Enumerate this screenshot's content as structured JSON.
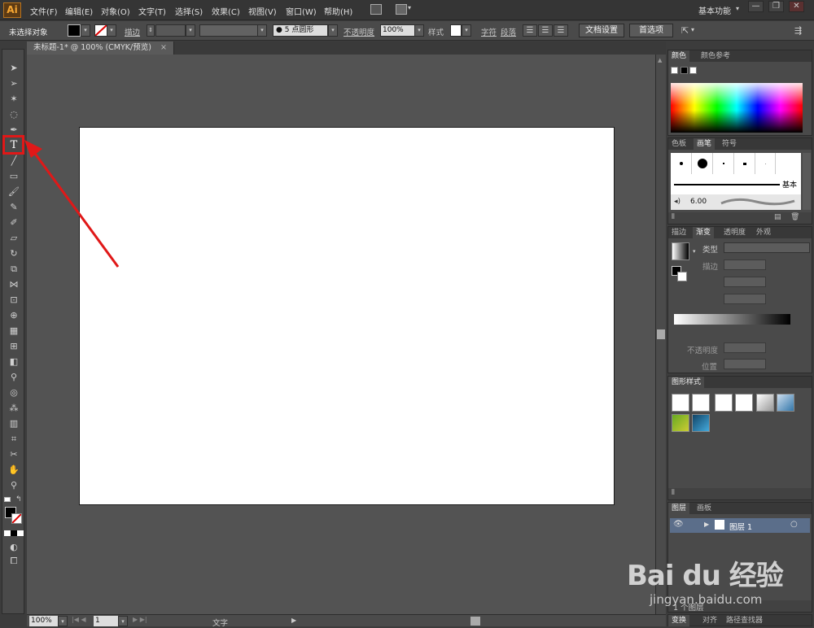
{
  "app": {
    "logo": "Ai"
  },
  "menubar": {
    "items": [
      "文件(F)",
      "编辑(E)",
      "对象(O)",
      "文字(T)",
      "选择(S)",
      "效果(C)",
      "视图(V)",
      "窗口(W)",
      "帮助(H)"
    ],
    "workspace": "基本功能",
    "window_buttons": [
      "—",
      "❐",
      "✕"
    ]
  },
  "controlbar": {
    "selection_status": "未选择对象",
    "stroke_label": "描边",
    "brush_size": "5",
    "brush_shape": "点圆形",
    "opacity_label": "不透明度",
    "opacity_value": "100%",
    "style_label": "样式",
    "char_label": "字符",
    "para_label": "段落",
    "doc_setup": "文档设置",
    "preferences": "首选项"
  },
  "document": {
    "tab_title": "未标题-1* @ 100% (CMYK/预览)",
    "close": "×"
  },
  "statusbar": {
    "zoom": "100%",
    "artboard_num": "1",
    "tool_name": "文字"
  },
  "panels": {
    "color": {
      "tabs": [
        "颜色",
        "颜色参考"
      ]
    },
    "brushes": {
      "tabs": [
        "色板",
        "画笔",
        "符号"
      ],
      "basic_label": "基本",
      "brush_size": "6.00"
    },
    "gradient": {
      "tabs": [
        "描边",
        "渐变",
        "透明度",
        "外观"
      ],
      "type_label": "类型",
      "stroke_label": "描边",
      "opacity_label": "不透明度",
      "position_label": "位置"
    },
    "graphic_styles": {
      "tabs": [
        "图形样式"
      ]
    },
    "layers": {
      "tabs": [
        "图层",
        "画板"
      ],
      "layer_name": "图层 1",
      "count": "1 个图层"
    },
    "bottom": {
      "tabs": [
        "变换",
        "对齐",
        "路径查找器"
      ]
    }
  },
  "watermark": {
    "brand": "Bai du 经验",
    "url": "jingyan.baidu.com"
  },
  "colors": {
    "accent_orange": "#f0a23a",
    "annotation_red": "#e01818",
    "ai_logo": "#f6a733"
  }
}
